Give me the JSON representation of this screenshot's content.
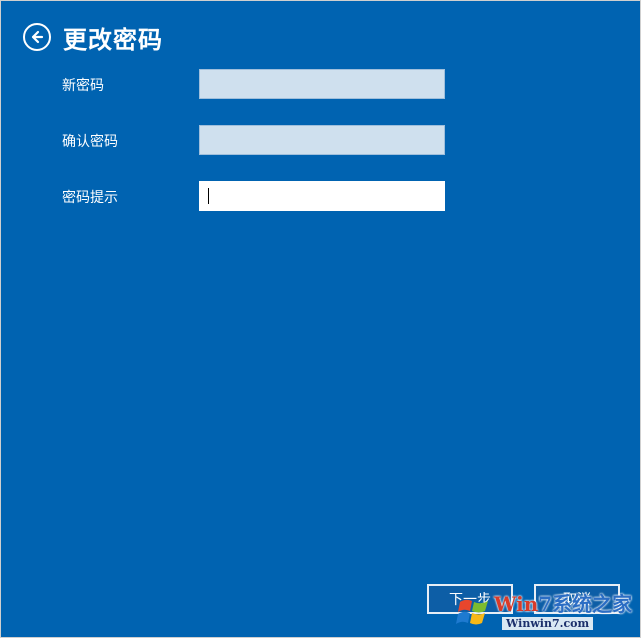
{
  "header": {
    "title": "更改密码"
  },
  "form": {
    "new_password_label": "新密码",
    "confirm_password_label": "确认密码",
    "hint_label": "密码提示",
    "new_password_value": "",
    "confirm_password_value": "",
    "hint_value": ""
  },
  "footer": {
    "next_label": "下一步",
    "cancel_label": "取消"
  },
  "watermark": {
    "brand_win": "Win",
    "brand_rest": "7系统之家",
    "url": "Winwin7.com"
  },
  "colors": {
    "background": "#0063b1",
    "field_inactive": "#cfe0ee",
    "field_active": "#ffffff"
  }
}
